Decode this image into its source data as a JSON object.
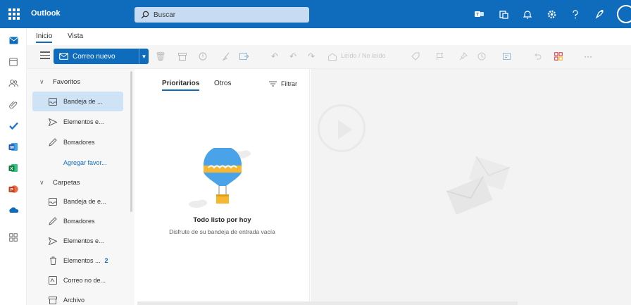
{
  "app": {
    "title": "Outlook"
  },
  "search": {
    "placeholder": "Buscar"
  },
  "ribbon": {
    "tabs": [
      {
        "label": "Inicio",
        "active": true
      },
      {
        "label": "Vista",
        "active": false
      }
    ]
  },
  "toolbar": {
    "new_mail_label": "Correo nuevo",
    "read_unread_label": "Leído / No leído",
    "icons": [
      "delete-icon",
      "archive-icon",
      "report-icon",
      "sweep-icon",
      "move-to-icon",
      "reply-icon",
      "reply-all-icon",
      "forward-icon",
      "tag-icon",
      "flag-icon",
      "pin-icon",
      "snooze-icon",
      "rules-icon",
      "undo-icon",
      "apps-icon",
      "more-icon"
    ]
  },
  "folders": {
    "favorites_label": "Favoritos",
    "favorites": [
      {
        "label": "Bandeja de ...",
        "icon": "inbox-icon",
        "selected": true
      },
      {
        "label": "Elementos e...",
        "icon": "sent-icon"
      },
      {
        "label": "Borradores",
        "icon": "drafts-icon"
      }
    ],
    "add_favorite_label": "Agregar favor...",
    "folders_label": "Carpetas",
    "folders": [
      {
        "label": "Bandeja de e...",
        "icon": "inbox-icon"
      },
      {
        "label": "Borradores",
        "icon": "drafts-icon"
      },
      {
        "label": "Elementos e...",
        "icon": "sent-icon"
      },
      {
        "label": "Elementos ...",
        "icon": "deleted-icon",
        "count": "2"
      },
      {
        "label": "Correo no de...",
        "icon": "junk-icon"
      },
      {
        "label": "Archivo",
        "icon": "archive-icon"
      }
    ]
  },
  "message_list": {
    "tabs": [
      {
        "label": "Prioritarios",
        "active": true
      },
      {
        "label": "Otros",
        "active": false
      }
    ],
    "filter_label": "Filtrar",
    "empty_title": "Todo listo por hoy",
    "empty_subtitle": "Disfrute de su bandeja de entrada vacía"
  },
  "colors": {
    "brand": "#0f6cbd",
    "selected": "#cfe3f7",
    "pane": "#f7f7f7"
  }
}
